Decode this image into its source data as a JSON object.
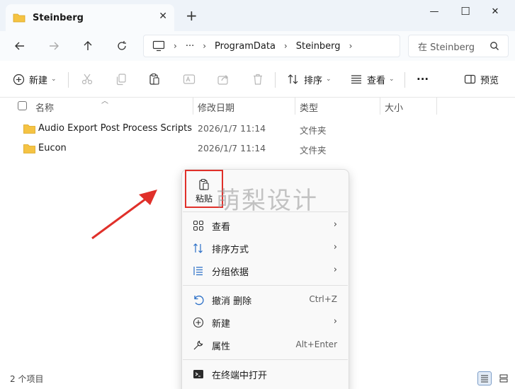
{
  "window": {
    "tab_title": "Steinberg",
    "new_tab": "+",
    "minimize": "—",
    "maximize": "☐",
    "close": "✕"
  },
  "nav": {
    "breadcrumb": [
      "ProgramData",
      "Steinberg"
    ],
    "ellipsis": "···",
    "search_placeholder": "在 Steinberg"
  },
  "toolbar": {
    "new_label": "新建",
    "sort_label": "排序",
    "view_label": "查看",
    "more_label": "···",
    "preview_label": "预览"
  },
  "columns": {
    "name": "名称",
    "modified": "修改日期",
    "type": "类型",
    "size": "大小"
  },
  "files": [
    {
      "name": "Audio Export Post Process Scripts",
      "modified": "2026/1/7 11:14",
      "type": "文件夹"
    },
    {
      "name": "Eucon",
      "modified": "2026/1/7 11:14",
      "type": "文件夹"
    }
  ],
  "status": {
    "item_count": "2 个项目"
  },
  "context_menu": {
    "paste_label": "粘贴",
    "watermark": "萌梨设计",
    "items": [
      {
        "icon": "view-icon",
        "label": "查看",
        "shortcut": "",
        "submenu": true
      },
      {
        "icon": "sort-icon",
        "label": "排序方式",
        "shortcut": "",
        "submenu": true
      },
      {
        "icon": "group-icon",
        "label": "分组依据",
        "shortcut": "",
        "submenu": true
      },
      {
        "icon": "undo-icon",
        "label": "撤消 删除",
        "shortcut": "Ctrl+Z",
        "submenu": false
      },
      {
        "icon": "new-icon",
        "label": "新建",
        "shortcut": "",
        "submenu": true
      },
      {
        "icon": "properties-icon",
        "label": "属性",
        "shortcut": "Alt+Enter",
        "submenu": false
      },
      {
        "icon": "terminal-icon",
        "label": "在终端中打开",
        "shortcut": "",
        "submenu": false
      }
    ],
    "chevron": "›"
  },
  "colors": {
    "accent_red": "#e0302a",
    "folder_yellow": "#f5c343",
    "titlebar_bg": "#eef3f9"
  }
}
